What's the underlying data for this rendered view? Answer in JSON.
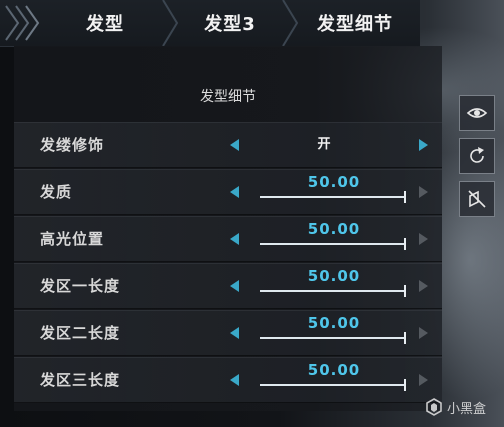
{
  "breadcrumb": {
    "items": [
      "发型",
      "发型3",
      "发型细节"
    ]
  },
  "panel": {
    "title": "发型细节"
  },
  "rows": [
    {
      "label": "发缕修饰",
      "type": "toggle",
      "value": "开"
    },
    {
      "label": "发质",
      "type": "slider",
      "value": "50.00",
      "fraction": 1.0
    },
    {
      "label": "高光位置",
      "type": "slider",
      "value": "50.00",
      "fraction": 1.0
    },
    {
      "label": "发区一长度",
      "type": "slider",
      "value": "50.00",
      "fraction": 1.0
    },
    {
      "label": "发区二长度",
      "type": "slider",
      "value": "50.00",
      "fraction": 1.0
    },
    {
      "label": "发区三长度",
      "type": "slider",
      "value": "50.00",
      "fraction": 1.0
    }
  ],
  "toolbar": {
    "icons": [
      "eye-icon",
      "rotate-icon",
      "hide-icon"
    ]
  },
  "watermark": {
    "text": "小黑盒"
  },
  "colors": {
    "accent": "#3aa8c8",
    "value_text": "#4fc6ea"
  }
}
